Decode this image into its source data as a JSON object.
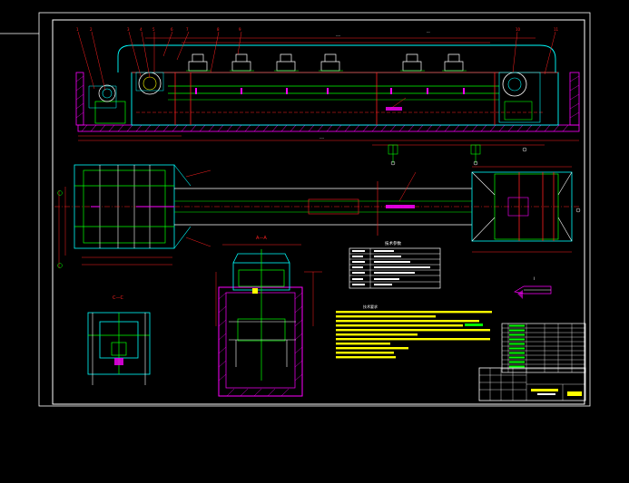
{
  "viewport": {
    "background": "#000000"
  },
  "colors": {
    "frame": "#ffffff",
    "cyan": "#00ffff",
    "green": "#00ff00",
    "red": "#ff2020",
    "magenta": "#ff00ff",
    "yellow": "#ffff00",
    "white": "#ffffff",
    "blue": "#4a7dff"
  },
  "drawing": {
    "section_label_a": "A—A",
    "section_label_b": "B—B",
    "section_label_c": "C—C",
    "detail_label": "I"
  },
  "tech_table": {
    "title": "技术参数",
    "rows": [
      "",
      "",
      "",
      "",
      "",
      "",
      ""
    ]
  },
  "notes": {
    "title": "技术要求",
    "lines": [
      "",
      "",
      "",
      "",
      "",
      "",
      "",
      "",
      "",
      "",
      ""
    ]
  },
  "title_block": {
    "rows": [
      "",
      "",
      "",
      "",
      "",
      "",
      "",
      "",
      "",
      ""
    ]
  }
}
